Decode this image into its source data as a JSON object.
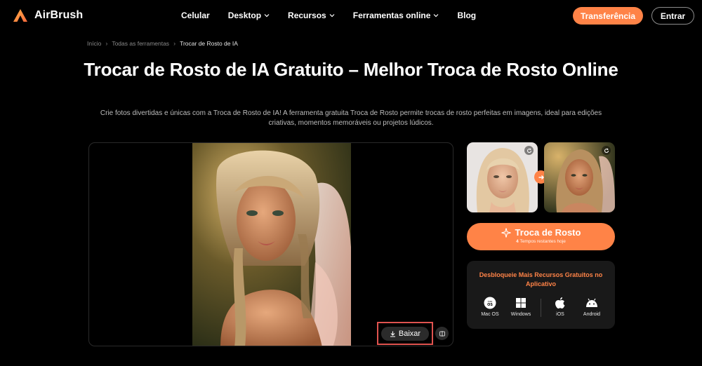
{
  "brand": {
    "name": "AirBrush",
    "accent": "#ff8347"
  },
  "nav": {
    "items": [
      {
        "label": "Celular",
        "dropdown": false
      },
      {
        "label": "Desktop",
        "dropdown": true
      },
      {
        "label": "Recursos",
        "dropdown": true
      },
      {
        "label": "Ferramentas online",
        "dropdown": true
      },
      {
        "label": "Blog",
        "dropdown": false
      }
    ],
    "transfer_label": "Transferência",
    "login_label": "Entrar"
  },
  "breadcrumb": {
    "items": [
      "Início",
      "Todas as ferramentas",
      "Trocar de Rosto de IA"
    ]
  },
  "page": {
    "title": "Trocar de Rosto de IA Gratuito – Melhor Troca de Rosto Online",
    "subtitle": "Crie fotos divertidas e únicas com a Troca de Rosto de IA! A ferramenta gratuita Troca de Rosto permite trocas de rosto perfeitas em imagens, ideal para edições criativas, momentos memoráveis ou projetos lúdicos."
  },
  "preview": {
    "download_label": "Baixar"
  },
  "swap": {
    "button_label": "Troca de Rosto",
    "remaining_count": "4",
    "remaining_text": "Tempos restantes hoje"
  },
  "app_promo": {
    "title": "Desbloqueie Mais Recursos Gratuitos no Aplicativo",
    "platforms": [
      {
        "label": "Mac OS",
        "icon": "macos-icon"
      },
      {
        "label": "Windows",
        "icon": "windows-icon"
      },
      {
        "label": "iOS",
        "icon": "apple-icon"
      },
      {
        "label": "Android",
        "icon": "android-icon"
      }
    ]
  }
}
